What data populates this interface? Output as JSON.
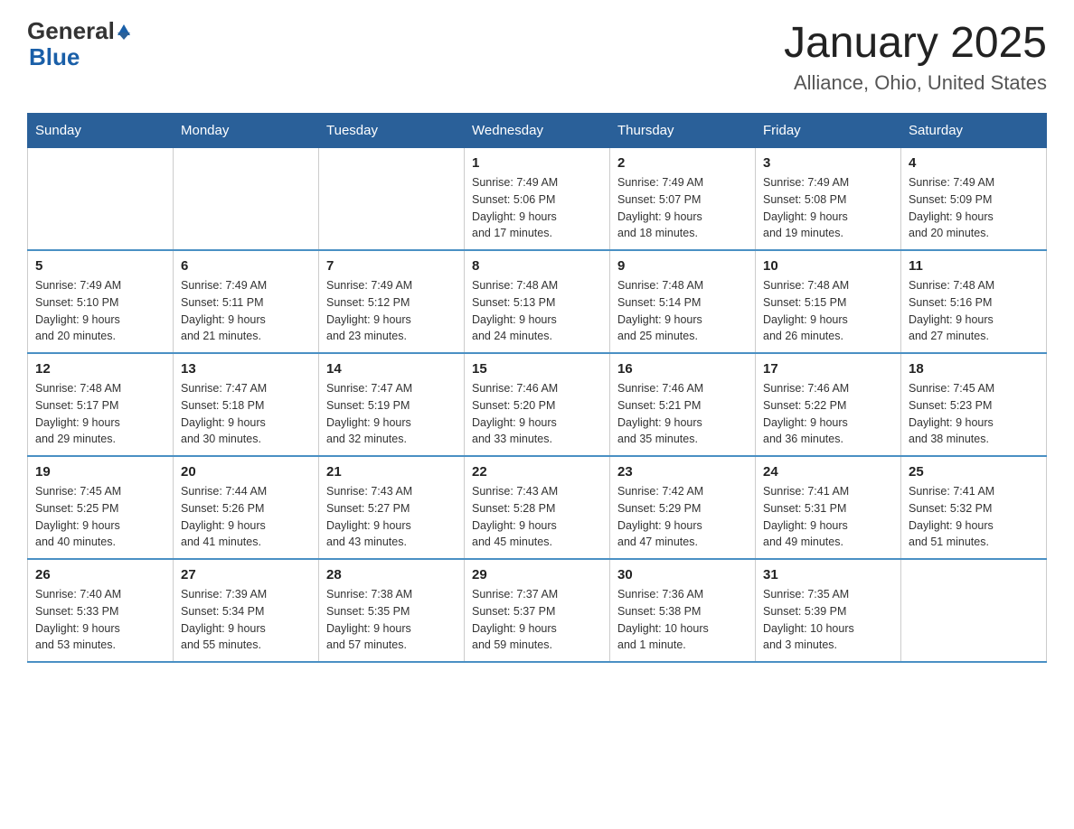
{
  "logo": {
    "text_general": "General",
    "text_blue": "Blue",
    "tagline": "GeneralBlue"
  },
  "title": "January 2025",
  "subtitle": "Alliance, Ohio, United States",
  "days_of_week": [
    "Sunday",
    "Monday",
    "Tuesday",
    "Wednesday",
    "Thursday",
    "Friday",
    "Saturday"
  ],
  "weeks": [
    [
      {
        "day": "",
        "info": ""
      },
      {
        "day": "",
        "info": ""
      },
      {
        "day": "",
        "info": ""
      },
      {
        "day": "1",
        "info": "Sunrise: 7:49 AM\nSunset: 5:06 PM\nDaylight: 9 hours\nand 17 minutes."
      },
      {
        "day": "2",
        "info": "Sunrise: 7:49 AM\nSunset: 5:07 PM\nDaylight: 9 hours\nand 18 minutes."
      },
      {
        "day": "3",
        "info": "Sunrise: 7:49 AM\nSunset: 5:08 PM\nDaylight: 9 hours\nand 19 minutes."
      },
      {
        "day": "4",
        "info": "Sunrise: 7:49 AM\nSunset: 5:09 PM\nDaylight: 9 hours\nand 20 minutes."
      }
    ],
    [
      {
        "day": "5",
        "info": "Sunrise: 7:49 AM\nSunset: 5:10 PM\nDaylight: 9 hours\nand 20 minutes."
      },
      {
        "day": "6",
        "info": "Sunrise: 7:49 AM\nSunset: 5:11 PM\nDaylight: 9 hours\nand 21 minutes."
      },
      {
        "day": "7",
        "info": "Sunrise: 7:49 AM\nSunset: 5:12 PM\nDaylight: 9 hours\nand 23 minutes."
      },
      {
        "day": "8",
        "info": "Sunrise: 7:48 AM\nSunset: 5:13 PM\nDaylight: 9 hours\nand 24 minutes."
      },
      {
        "day": "9",
        "info": "Sunrise: 7:48 AM\nSunset: 5:14 PM\nDaylight: 9 hours\nand 25 minutes."
      },
      {
        "day": "10",
        "info": "Sunrise: 7:48 AM\nSunset: 5:15 PM\nDaylight: 9 hours\nand 26 minutes."
      },
      {
        "day": "11",
        "info": "Sunrise: 7:48 AM\nSunset: 5:16 PM\nDaylight: 9 hours\nand 27 minutes."
      }
    ],
    [
      {
        "day": "12",
        "info": "Sunrise: 7:48 AM\nSunset: 5:17 PM\nDaylight: 9 hours\nand 29 minutes."
      },
      {
        "day": "13",
        "info": "Sunrise: 7:47 AM\nSunset: 5:18 PM\nDaylight: 9 hours\nand 30 minutes."
      },
      {
        "day": "14",
        "info": "Sunrise: 7:47 AM\nSunset: 5:19 PM\nDaylight: 9 hours\nand 32 minutes."
      },
      {
        "day": "15",
        "info": "Sunrise: 7:46 AM\nSunset: 5:20 PM\nDaylight: 9 hours\nand 33 minutes."
      },
      {
        "day": "16",
        "info": "Sunrise: 7:46 AM\nSunset: 5:21 PM\nDaylight: 9 hours\nand 35 minutes."
      },
      {
        "day": "17",
        "info": "Sunrise: 7:46 AM\nSunset: 5:22 PM\nDaylight: 9 hours\nand 36 minutes."
      },
      {
        "day": "18",
        "info": "Sunrise: 7:45 AM\nSunset: 5:23 PM\nDaylight: 9 hours\nand 38 minutes."
      }
    ],
    [
      {
        "day": "19",
        "info": "Sunrise: 7:45 AM\nSunset: 5:25 PM\nDaylight: 9 hours\nand 40 minutes."
      },
      {
        "day": "20",
        "info": "Sunrise: 7:44 AM\nSunset: 5:26 PM\nDaylight: 9 hours\nand 41 minutes."
      },
      {
        "day": "21",
        "info": "Sunrise: 7:43 AM\nSunset: 5:27 PM\nDaylight: 9 hours\nand 43 minutes."
      },
      {
        "day": "22",
        "info": "Sunrise: 7:43 AM\nSunset: 5:28 PM\nDaylight: 9 hours\nand 45 minutes."
      },
      {
        "day": "23",
        "info": "Sunrise: 7:42 AM\nSunset: 5:29 PM\nDaylight: 9 hours\nand 47 minutes."
      },
      {
        "day": "24",
        "info": "Sunrise: 7:41 AM\nSunset: 5:31 PM\nDaylight: 9 hours\nand 49 minutes."
      },
      {
        "day": "25",
        "info": "Sunrise: 7:41 AM\nSunset: 5:32 PM\nDaylight: 9 hours\nand 51 minutes."
      }
    ],
    [
      {
        "day": "26",
        "info": "Sunrise: 7:40 AM\nSunset: 5:33 PM\nDaylight: 9 hours\nand 53 minutes."
      },
      {
        "day": "27",
        "info": "Sunrise: 7:39 AM\nSunset: 5:34 PM\nDaylight: 9 hours\nand 55 minutes."
      },
      {
        "day": "28",
        "info": "Sunrise: 7:38 AM\nSunset: 5:35 PM\nDaylight: 9 hours\nand 57 minutes."
      },
      {
        "day": "29",
        "info": "Sunrise: 7:37 AM\nSunset: 5:37 PM\nDaylight: 9 hours\nand 59 minutes."
      },
      {
        "day": "30",
        "info": "Sunrise: 7:36 AM\nSunset: 5:38 PM\nDaylight: 10 hours\nand 1 minute."
      },
      {
        "day": "31",
        "info": "Sunrise: 7:35 AM\nSunset: 5:39 PM\nDaylight: 10 hours\nand 3 minutes."
      },
      {
        "day": "",
        "info": ""
      }
    ]
  ]
}
